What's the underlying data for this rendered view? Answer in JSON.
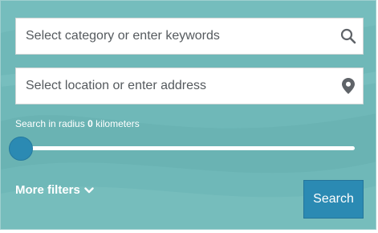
{
  "search": {
    "keywords_placeholder": "Select category or enter keywords",
    "location_placeholder": "Select location or enter address",
    "radius_prefix": "Search in radius",
    "radius_value": "0",
    "radius_unit": "kilometers",
    "radius_slider_fraction": 0,
    "more_filters_label": "More filters",
    "search_button_label": "Search"
  },
  "icons": {
    "keywords": "search-icon",
    "location": "map-pin-icon",
    "more_filters": "chevron-down-icon"
  },
  "colors": {
    "panel_background": "#6fb8b8",
    "accent": "#2b8ab3",
    "text_light": "#ffffff"
  }
}
